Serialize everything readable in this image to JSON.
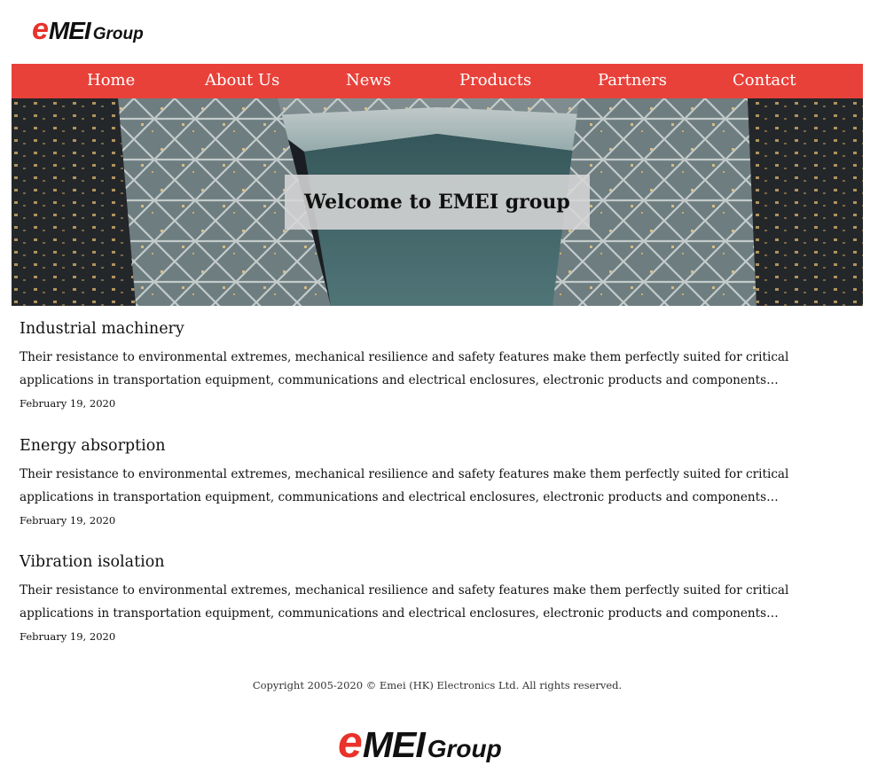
{
  "logo": {
    "e": "e",
    "mei": "MEI",
    "group": "Group"
  },
  "nav": [
    {
      "label": "Home"
    },
    {
      "label": "About Us"
    },
    {
      "label": "News"
    },
    {
      "label": "Products"
    },
    {
      "label": "Partners"
    },
    {
      "label": "Contact"
    }
  ],
  "hero": {
    "title": "Welcome to EMEI group"
  },
  "articles": [
    {
      "title": "Industrial machinery",
      "excerpt": "Their resistance to environmental extremes, mechanical resilience and safety features make them perfectly suited for critical applications in transportation equipment, communications and electrical enclosures, electronic products and components…",
      "date": "February 19, 2020"
    },
    {
      "title": "Energy absorption",
      "excerpt": "Their resistance to environmental extremes, mechanical resilience and safety features make them perfectly suited for critical applications in transportation equipment, communications and electrical enclosures, electronic products and components…",
      "date": "February 19, 2020"
    },
    {
      "title": "Vibration isolation",
      "excerpt": "Their resistance to environmental extremes, mechanical resilience and safety features make them perfectly suited for critical applications in transportation equipment, communications and electrical enclosures, electronic products and components…",
      "date": "February 19, 2020"
    }
  ],
  "footer": {
    "copyright": "Copyright 2005-2020 © Emei (HK) Electronics Ltd. All rights reserved."
  },
  "colors": {
    "brand_red": "#e8413a",
    "logo_red": "#e8322a"
  }
}
